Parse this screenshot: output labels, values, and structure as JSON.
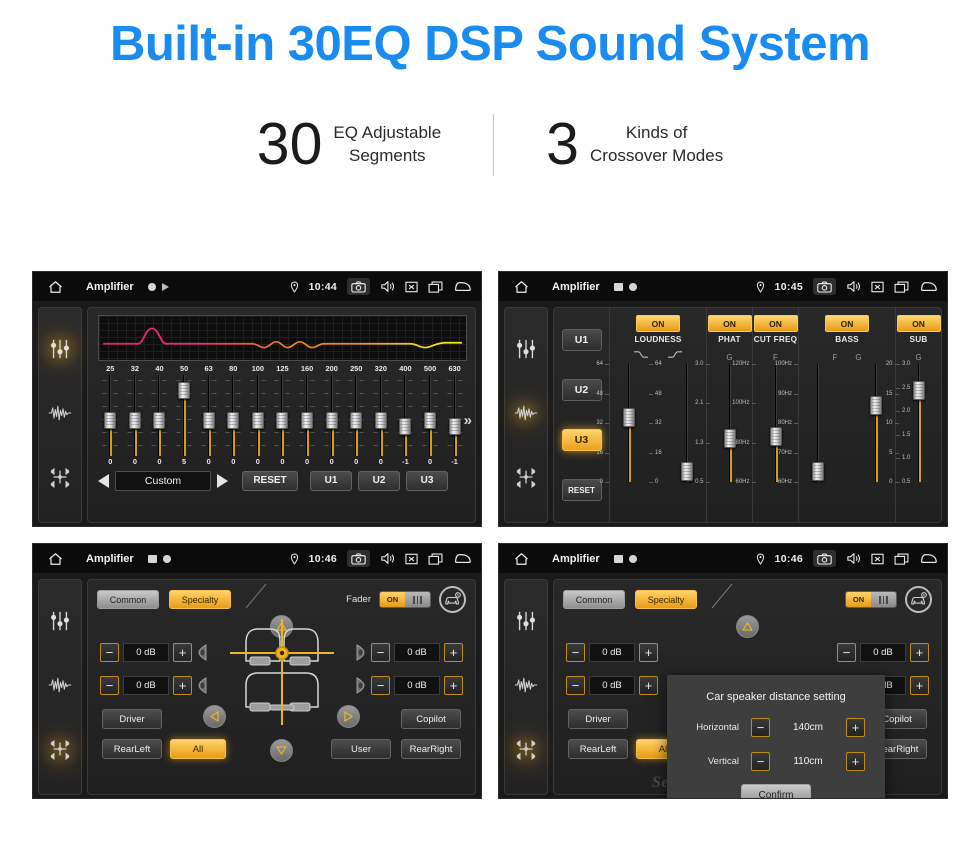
{
  "hero": {
    "title": "Built-in 30EQ DSP Sound System",
    "stats": [
      {
        "number": "30",
        "label_line1": "EQ Adjustable",
        "label_line2": "Segments"
      },
      {
        "number": "3",
        "label_line1": "Kinds of",
        "label_line2": "Crossover Modes"
      }
    ]
  },
  "colors": {
    "brand_blue": "#1a8cf0",
    "accent_amber": "#e79c14",
    "track_fill": "#d99a15",
    "panel_bg": "#1a1a1a"
  },
  "panels": {
    "eq": {
      "statusbar": {
        "app_title": "Amplifier",
        "clock": "10:44",
        "icons": [
          "home-icon",
          "recording-dot-icon",
          "play-icon",
          "location-pin-icon",
          "camera-icon",
          "volume-icon",
          "close-box-icon",
          "recents-icon",
          "back-icon"
        ]
      },
      "rail": [
        "equalizer-icon",
        "waveform-icon",
        "balance-icon"
      ],
      "active_rail": "equalizer-icon",
      "frequencies": [
        "25",
        "32",
        "40",
        "50",
        "63",
        "80",
        "100",
        "125",
        "160",
        "200",
        "250",
        "320",
        "400",
        "500",
        "630"
      ],
      "values": [
        "0",
        "0",
        "0",
        "5",
        "0",
        "0",
        "0",
        "0",
        "0",
        "0",
        "0",
        "0",
        "-1",
        "0",
        "-1"
      ],
      "preset": "Custom",
      "reset_label": "RESET",
      "user_presets": [
        "U1",
        "U2",
        "U3"
      ],
      "more_icon": "chevron-double-right-icon"
    },
    "crossover": {
      "statusbar": {
        "app_title": "Amplifier",
        "clock": "10:45"
      },
      "active_rail": "waveform-icon",
      "presets": [
        "U1",
        "U2",
        "U3"
      ],
      "active_preset": "U3",
      "reset_label": "RESET",
      "sections": [
        {
          "name": "LOUDNESS",
          "state": "ON",
          "sliders": [
            {
              "cap": "low-shelf-curve-icon",
              "scale_left": [
                "64",
                "48",
                "32",
                "16",
                "0"
              ],
              "scale_right": [
                "64",
                "48",
                "32",
                "16",
                "0"
              ],
              "value_pct": 50
            },
            {
              "cap": "high-shelf-curve-icon",
              "scale_left": [],
              "scale_right": [],
              "value_pct": 4
            }
          ]
        },
        {
          "name": "PHAT",
          "state": "ON",
          "sliders": [
            {
              "cap": "G",
              "scale_left": [
                "3.0",
                "2.1",
                "1.3",
                "0.5"
              ],
              "value_pct": 32
            }
          ]
        },
        {
          "name": "CUT FREQ",
          "state": "ON",
          "sliders": [
            {
              "cap": "F",
              "scale_left": [
                "120Hz",
                "100Hz",
                "80Hz",
                "60Hz"
              ],
              "value_pct": 34
            }
          ]
        },
        {
          "name": "BASS",
          "state": "ON",
          "sliders": [
            {
              "cap": "F",
              "scale_left": [
                "100Hz",
                "90Hz",
                "80Hz",
                "70Hz",
                "60Hz"
              ],
              "value_pct": 4
            },
            {
              "cap": "G",
              "scale_right": [
                "3.0",
                "2.5",
                "2.0",
                "1.5",
                "1.0",
                "0.5"
              ],
              "value_pct": 60
            }
          ]
        },
        {
          "name": "SUB",
          "state": "ON",
          "sliders": [
            {
              "cap": "G",
              "scale_left": [
                "20",
                "15",
                "10",
                "5",
                "0"
              ],
              "value_pct": 73
            }
          ]
        }
      ]
    },
    "fader": {
      "statusbar": {
        "app_title": "Amplifier",
        "clock": "10:46"
      },
      "active_rail": "balance-icon",
      "tabs": [
        "Common",
        "Specialty"
      ],
      "active_tab": "Specialty",
      "fader_label": "Fader",
      "fader_state": "ON",
      "car_settings_icon": "car-settings-icon",
      "channels": [
        {
          "pos": "front-left",
          "value": "0 dB"
        },
        {
          "pos": "front-right",
          "value": "0 dB"
        },
        {
          "pos": "rear-left",
          "value": "0 dB"
        },
        {
          "pos": "rear-right",
          "value": "0 dB"
        }
      ],
      "minus": "−",
      "plus": "+",
      "seat_buttons": [
        "Driver",
        "Copilot",
        "RearLeft",
        "All",
        "User",
        "RearRight"
      ],
      "active_seat": "All"
    },
    "dialog": {
      "statusbar": {
        "app_title": "Amplifier",
        "clock": "10:46"
      },
      "title": "Car speaker distance setting",
      "rows": [
        {
          "label": "Horizontal",
          "value": "140cm"
        },
        {
          "label": "Vertical",
          "value": "110cm"
        }
      ],
      "confirm_label": "Confirm",
      "watermark": "Seicane"
    }
  }
}
